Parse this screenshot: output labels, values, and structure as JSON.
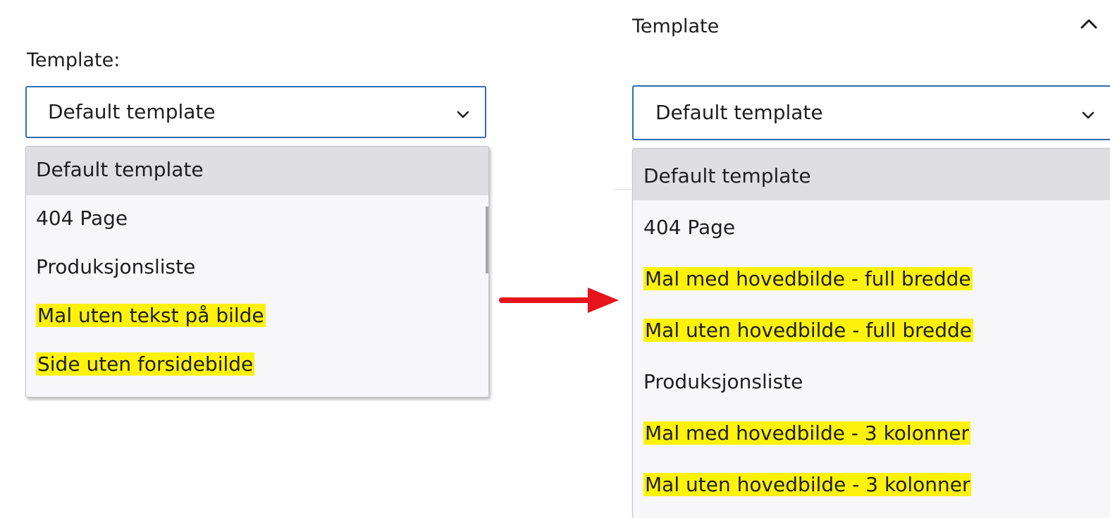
{
  "left": {
    "label": "Template:",
    "selected_value": "Default template",
    "options": [
      {
        "label": "Default template",
        "highlighted": false,
        "selected": true
      },
      {
        "label": "404 Page",
        "highlighted": false,
        "selected": false
      },
      {
        "label": "Produksjonsliste",
        "highlighted": false,
        "selected": false
      },
      {
        "label": "Mal uten tekst på bilde",
        "highlighted": true,
        "selected": false
      },
      {
        "label": "Side uten forsidebilde",
        "highlighted": true,
        "selected": false
      }
    ]
  },
  "right": {
    "label": "Template",
    "selected_value": "Default template",
    "options": [
      {
        "label": "Default template",
        "highlighted": false,
        "selected": true
      },
      {
        "label": "404 Page",
        "highlighted": false,
        "selected": false
      },
      {
        "label": "Mal med hovedbilde - full bredde",
        "highlighted": true,
        "selected": false
      },
      {
        "label": "Mal uten hovedbilde - full bredde",
        "highlighted": true,
        "selected": false
      },
      {
        "label": "Produksjonsliste",
        "highlighted": false,
        "selected": false
      },
      {
        "label": "Mal med hovedbilde - 3 kolonner",
        "highlighted": true,
        "selected": false
      },
      {
        "label": "Mal uten hovedbilde - 3 kolonner",
        "highlighted": true,
        "selected": false
      }
    ]
  },
  "icons": {
    "dropdown": "chevron-down-icon",
    "collapse": "chevron-up-icon",
    "transition": "arrow-right-icon"
  },
  "colors": {
    "focus_border": "#2f6fae",
    "highlight": "#fff20a",
    "arrow": "#e8141c",
    "selected_option_bg": "#dfdfe2",
    "list_bg": "#f7f7fa"
  }
}
